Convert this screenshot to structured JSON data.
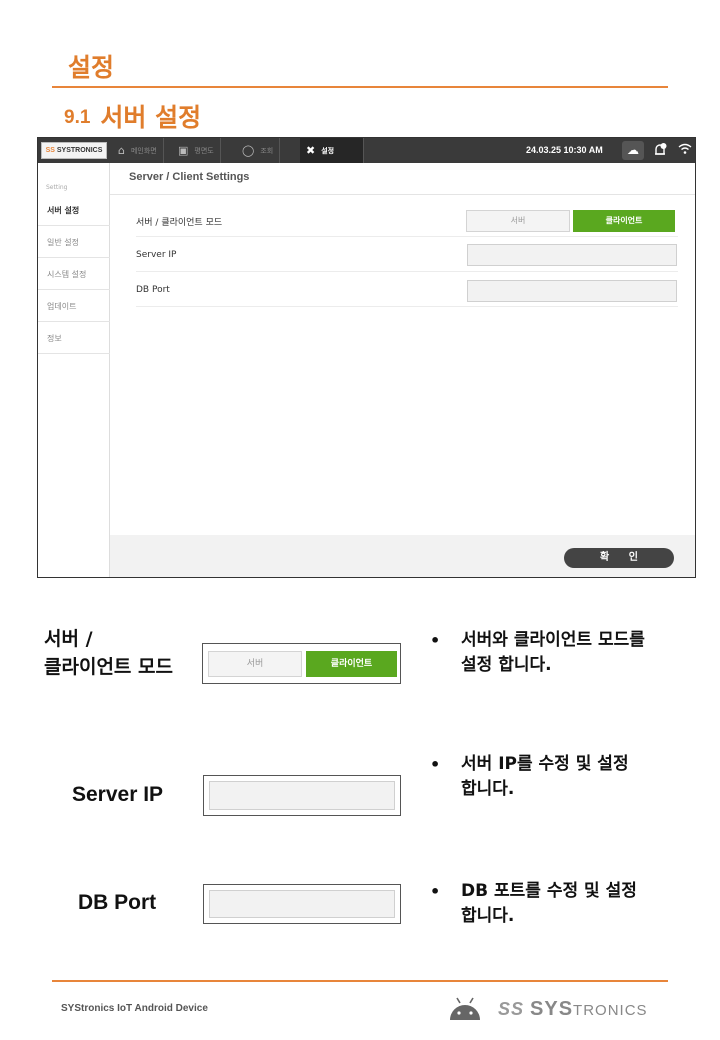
{
  "heading": {
    "title": "설정",
    "section_number": "9.1",
    "section_title": "서버 설정"
  },
  "device": {
    "statusbar": {
      "logo": "SYSTRONICS",
      "logo_mark": "SS",
      "nav": [
        {
          "icon": "home-icon",
          "label": "메인화면"
        },
        {
          "icon": "floorplan-icon",
          "label": "평면도"
        },
        {
          "icon": "search-icon",
          "label": "조회"
        },
        {
          "icon": "tools-icon",
          "label": "설정"
        }
      ],
      "datetime": "24.03.25 10:30 AM",
      "icons": [
        "cloud-icon",
        "bell-icon",
        "wifi-icon"
      ],
      "notification_count": "0"
    },
    "sidebar": {
      "label": "Setting",
      "items": [
        "서버 설정",
        "일반 설정",
        "시스템 설정",
        "업데이트",
        "정보"
      ],
      "active_index": 0
    },
    "panel": {
      "title": "Server / Client Settings",
      "rows": [
        {
          "label": "서버 / 클라이언트 모드"
        },
        {
          "label": "Server IP",
          "value": ""
        },
        {
          "label": "DB Port",
          "value": ""
        }
      ],
      "mode_options": [
        "서버",
        "클라이언트"
      ],
      "mode_selected": "클라이언트",
      "confirm_button": "확 인"
    }
  },
  "details": [
    {
      "label_line1": "서버 /",
      "label_line2": "클라이언트 모드",
      "option_off": "서버",
      "option_on": "클라이언트",
      "description_line1": "서버와 클라이언트 모드를",
      "description_line2": "설정 합니다."
    },
    {
      "label": "Server IP",
      "description_line1": "서버 IP를 수정 및 설정",
      "description_line2": "합니다."
    },
    {
      "label": "DB Port",
      "description_line1": "DB 포트를 수정 및 설정",
      "description_line2": "합니다."
    }
  ],
  "bullet": "•",
  "footer": {
    "text": "SYStronics IoT Android Device",
    "logo_mark": "SS",
    "logo_big1": "SYS",
    "logo_small": "TRONICS"
  },
  "colors": {
    "accent": "#e8853a",
    "green": "#5aa81f",
    "dark": "#3a3a3a"
  }
}
